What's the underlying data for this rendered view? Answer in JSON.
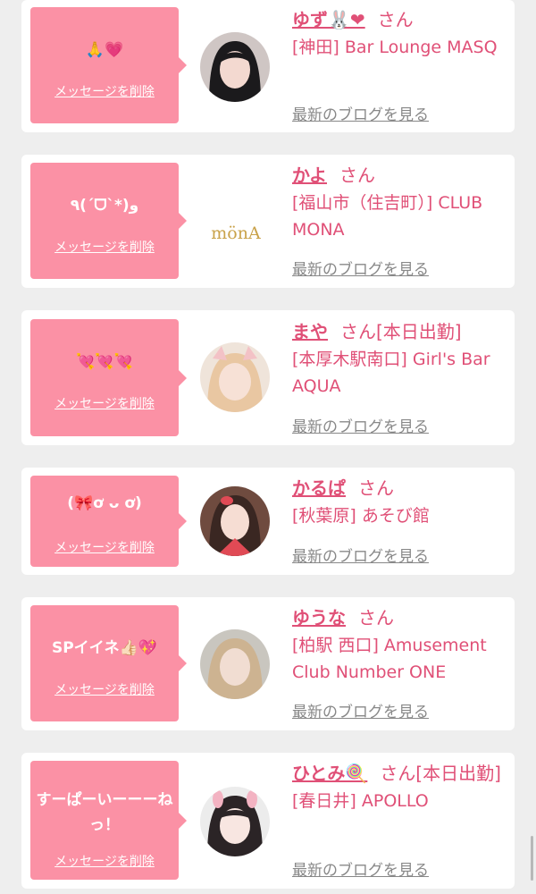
{
  "items": [
    {
      "message": "🙏💗",
      "delete_label": "メッセージを削除",
      "name": "ゆず🐰❤",
      "honorific": "さん",
      "shop": "[神田] Bar Lounge MASQ",
      "blog_label": "最新のブログを見る"
    },
    {
      "message": "٩(ˊᗜˋ*)و",
      "delete_label": "メッセージを削除",
      "name": "かよ",
      "honorific": "さん",
      "shop": "[福山市（住吉町）] CLUB MONA",
      "blog_label": "最新のブログを見る",
      "logo_text": "mönA"
    },
    {
      "message": "💘💘💘",
      "delete_label": "メッセージを削除",
      "name": "まや",
      "honorific": "さん[本日出勤]",
      "shop": "[本厚木駅南口] Girl's Bar AQUA",
      "blog_label": "最新のブログを見る"
    },
    {
      "message": "(🎀ơ ᴗ ơ)",
      "delete_label": "メッセージを削除",
      "name": "かるぱ",
      "honorific": "さん",
      "shop": "[秋葉原] あそび館",
      "blog_label": "最新のブログを見る"
    },
    {
      "message": "SPイイネ👍🏻💖",
      "delete_label": "メッセージを削除",
      "name": "ゆうな",
      "honorific": "さん",
      "shop": "[柏駅 西口] Amusement Club Number ONE",
      "blog_label": "最新のブログを見る"
    },
    {
      "message": "すーぱーいーーーねっ！",
      "delete_label": "メッセージを削除",
      "name": "ひとみ🍭",
      "honorific": "さん[本日出勤]",
      "shop": "[春日井] APOLLO",
      "blog_label": "最新のブログを見る"
    }
  ],
  "colors": {
    "bubble": "#fb91a5",
    "accent": "#e05077",
    "link_gray": "#888888",
    "background": "#eeeeee"
  }
}
